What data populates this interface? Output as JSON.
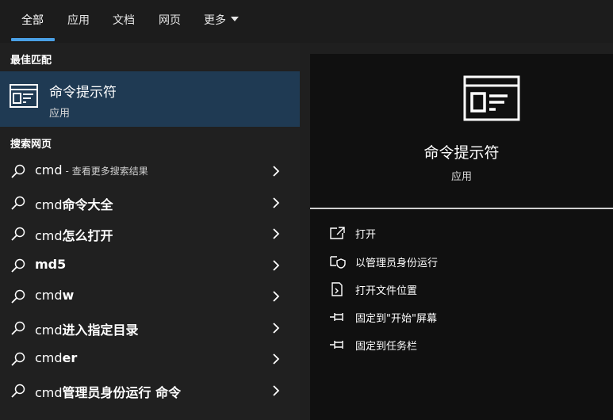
{
  "tabs": [
    {
      "label": "全部",
      "active": true
    },
    {
      "label": "应用",
      "active": false
    },
    {
      "label": "文档",
      "active": false
    },
    {
      "label": "网页",
      "active": false
    },
    {
      "label": "更多",
      "active": false
    }
  ],
  "accent_color": "#4aa0e6",
  "best_match": {
    "section_label": "最佳匹配",
    "title": "命令提示符",
    "subtitle": "应用",
    "icon": "cmd-app-icon"
  },
  "web_search": {
    "section_label": "搜索网页",
    "results": [
      {
        "prefix": "cmd",
        "bold": "",
        "hint": "- 查看更多搜索结果"
      },
      {
        "prefix": "cmd",
        "bold": "命令大全",
        "hint": ""
      },
      {
        "prefix": "cmd",
        "bold": "怎么打开",
        "hint": ""
      },
      {
        "prefix": "",
        "bold": "md5",
        "hint": ""
      },
      {
        "prefix": "cmd",
        "bold": "w",
        "hint": ""
      },
      {
        "prefix": "cmd",
        "bold": "进入指定目录",
        "hint": ""
      },
      {
        "prefix": "cmd",
        "bold": "er",
        "hint": ""
      },
      {
        "prefix": "cmd",
        "bold": "管理员身份运行 命令",
        "hint": ""
      }
    ]
  },
  "preview": {
    "title": "命令提示符",
    "type": "应用",
    "actions": [
      {
        "label": "打开",
        "icon": "open-icon"
      },
      {
        "label": "以管理员身份运行",
        "icon": "run-as-admin-icon"
      },
      {
        "label": "打开文件位置",
        "icon": "file-location-icon"
      },
      {
        "label": "固定到\"开始\"屏幕",
        "icon": "pin-start-icon"
      },
      {
        "label": "固定到任务栏",
        "icon": "pin-taskbar-icon"
      }
    ]
  }
}
